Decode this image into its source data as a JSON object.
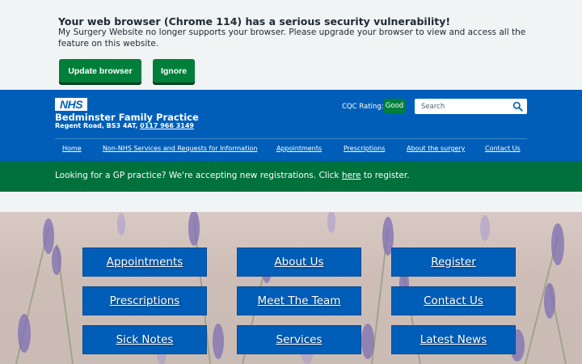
{
  "browser_warning": {
    "title": "Your web browser (Chrome 114) has a serious security vulnerability!",
    "text": "My Surgery Website no longer supports your browser. Please upgrade your browser to view and access all the feature on this website.",
    "update_label": "Update browser",
    "ignore_label": "Ignore"
  },
  "header": {
    "logo_text": "NHS",
    "practice_name": "Bedminster Family Practice",
    "address": "Regent Road, BS3 4AT,",
    "phone": "0117 966 3149",
    "cqc_label": "CQC Rating:",
    "cqc_value": "Good",
    "search_placeholder": "Search"
  },
  "nav": {
    "items": [
      {
        "label": "Home"
      },
      {
        "label": "Non-NHS Services and Requests for Information"
      },
      {
        "label": "Appointments"
      },
      {
        "label": "Prescriptions"
      },
      {
        "label": "About the surgery"
      },
      {
        "label": "Contact Us"
      }
    ]
  },
  "banner": {
    "text_before": "Looking for a GP practice? We're accepting new registrations. Click",
    "link": "here",
    "text_after": "to register."
  },
  "tiles": [
    {
      "label": "Appointments"
    },
    {
      "label": "About Us"
    },
    {
      "label": "Register"
    },
    {
      "label": "Prescriptions"
    },
    {
      "label": "Meet The Team"
    },
    {
      "label": "Contact Us"
    },
    {
      "label": "Sick Notes"
    },
    {
      "label": "Services"
    },
    {
      "label": "Latest News"
    }
  ],
  "colors": {
    "nhs_blue": "#005eb8",
    "nhs_green": "#007f3b",
    "banner_green": "#00703c"
  }
}
